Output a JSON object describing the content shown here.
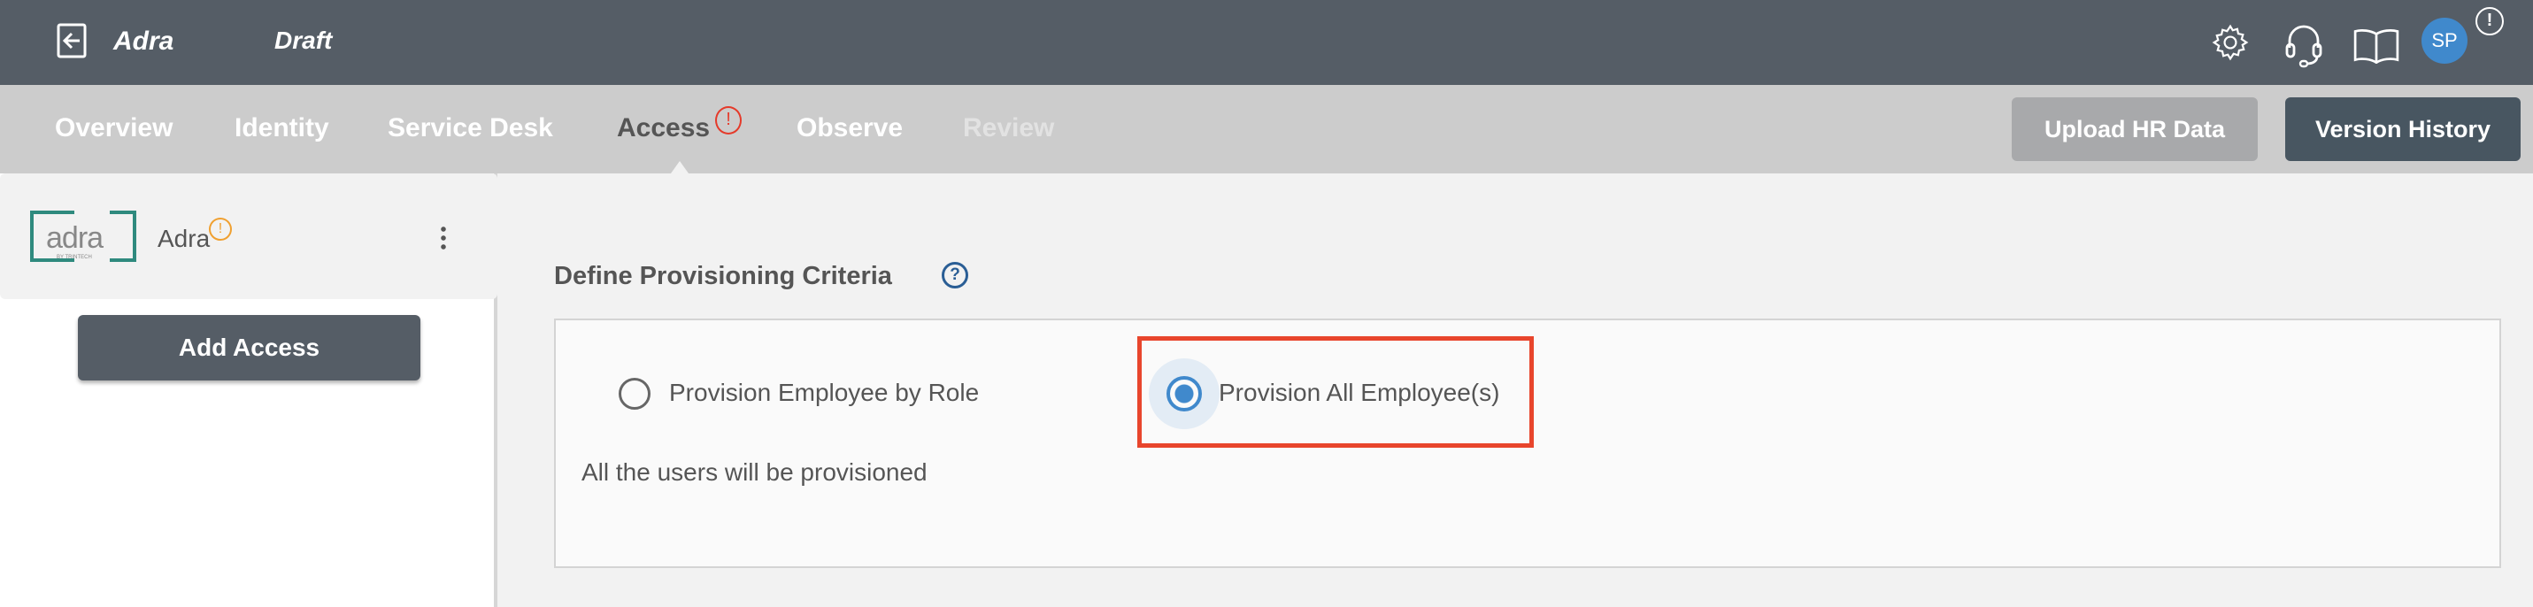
{
  "header": {
    "app_title": "Adra",
    "status": "Draft",
    "avatar_initials": "SP",
    "icons": [
      "exit-icon",
      "gear-icon",
      "headset-icon",
      "book-icon",
      "alert-icon"
    ]
  },
  "nav": {
    "tabs": [
      {
        "label": "Overview"
      },
      {
        "label": "Identity"
      },
      {
        "label": "Service Desk"
      },
      {
        "label": "Access",
        "active": true,
        "alert": true
      },
      {
        "label": "Observe"
      },
      {
        "label": "Review",
        "disabled": true
      }
    ],
    "upload_label": "Upload HR Data",
    "version_label": "Version History"
  },
  "sidebar": {
    "app_name": "Adra",
    "logo_text": "adra",
    "logo_subtext": "BY TRINTECH",
    "add_access_label": "Add Access"
  },
  "main": {
    "heading": "Define Provisioning Criteria",
    "options": [
      {
        "label": "Provision Employee by Role",
        "selected": false
      },
      {
        "label": "Provision All Employee(s)",
        "selected": true
      }
    ],
    "info": "All the users will be provisioned"
  },
  "colors": {
    "topbar": "#555d66",
    "accent": "#4089cc",
    "alert": "#e53a2a",
    "warning": "#f0a030",
    "highlight": "#e8452c"
  }
}
